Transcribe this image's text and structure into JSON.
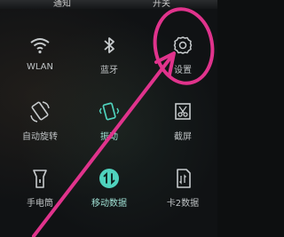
{
  "top": {
    "left_label": "通知",
    "right_label": "开关"
  },
  "tiles": [
    {
      "label": "WLAN",
      "icon": "wifi-icon",
      "active": false
    },
    {
      "label": "蓝牙",
      "icon": "bluetooth-icon",
      "active": false
    },
    {
      "label": "设置",
      "icon": "gear-icon",
      "active": false
    },
    {
      "label": "自动旋转",
      "icon": "auto-rotate-icon",
      "active": false
    },
    {
      "label": "振动",
      "icon": "vibrate-icon",
      "active": true
    },
    {
      "label": "截屏",
      "icon": "screenshot-icon",
      "active": false
    },
    {
      "label": "手电筒",
      "icon": "flashlight-icon",
      "active": false
    },
    {
      "label": "移动数据",
      "icon": "mobile-data-icon",
      "active": true
    },
    {
      "label": "卡2数据",
      "icon": "sim2-data-icon",
      "active": false
    }
  ],
  "colors": {
    "accent": "#4fd2bd",
    "annotation": "#e0338c",
    "icon_inactive": "#c7cbcd"
  }
}
